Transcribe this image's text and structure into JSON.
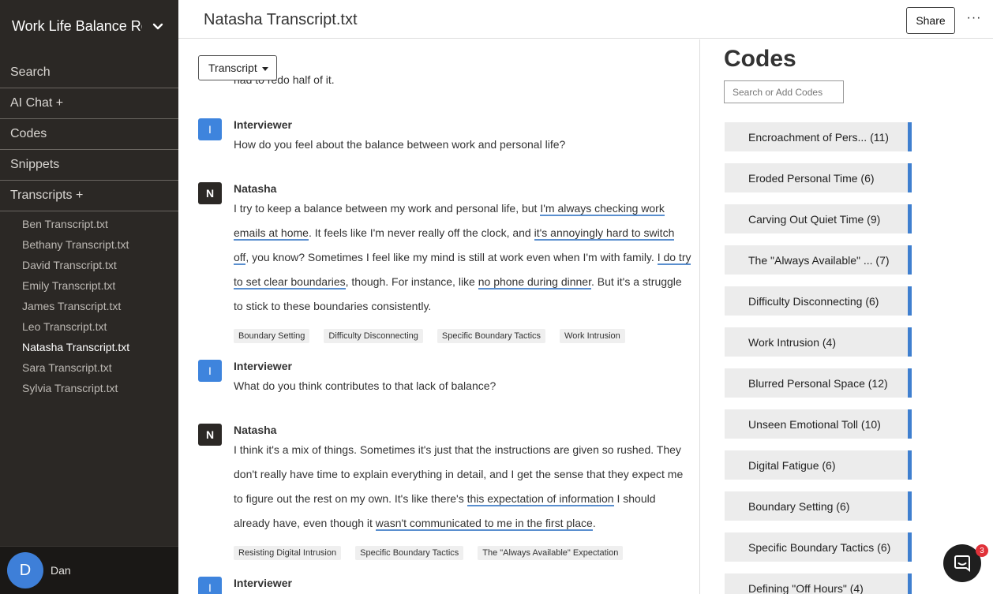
{
  "workspace": {
    "title": "Work Life Balance Re"
  },
  "nav": [
    {
      "label": "Search"
    },
    {
      "label": "AI Chat +"
    },
    {
      "label": "Codes"
    },
    {
      "label": "Snippets"
    },
    {
      "label": "Transcripts +"
    }
  ],
  "files": [
    "Ben Transcript.txt",
    "Bethany Transcript.txt",
    "David Transcript.txt",
    "Emily Transcript.txt",
    "James Transcript.txt",
    "Leo Transcript.txt",
    "Natasha Transcript.txt",
    "Sara Transcript.txt",
    "Sylvia Transcript.txt"
  ],
  "active_file": "Natasha Transcript.txt",
  "user": {
    "initial": "D",
    "name": "Dan"
  },
  "header": {
    "title": "Natasha Transcript.txt",
    "share": "Share",
    "more": "···"
  },
  "transcript": {
    "view_label": "Transcript",
    "cut_line": "had to redo half of it.",
    "messages": [
      {
        "badge": "I",
        "speaker": "Interviewer",
        "text": "How do you feel about the balance between work and personal life?"
      },
      {
        "badge": "N",
        "speaker": "Natasha",
        "p1": "I try to keep a balance between my work and personal life, but ",
        "h1": "I'm always checking work emails at home",
        "p2": ". It feels like I'm never really off the clock, and ",
        "h2": "it's annoyingly hard to switch off",
        "p3": ", you know? Sometimes I feel like my mind is still at work even when I'm with family. ",
        "h3": "I do try to set clear boundaries",
        "p4": ", though. For instance, like ",
        "h4": "no phone during dinner",
        "p5": ". But it's a struggle to stick to these boundaries consistently.",
        "tags": [
          "Boundary Setting",
          "Difficulty Disconnecting",
          "Specific Boundary Tactics",
          "Work Intrusion"
        ]
      },
      {
        "badge": "I",
        "speaker": "Interviewer",
        "text": "What do you think contributes to that lack of balance?"
      },
      {
        "badge": "N",
        "speaker": "Natasha",
        "p1": "I think it's a mix of things. Sometimes it's just that the instructions are given so rushed. They don't really have time to explain everything in detail, and I get the sense that they expect me to figure out the rest on my own. It's like there's ",
        "h1": "this expectation of information",
        "p2": " I should already have, even though it ",
        "h2": "wasn't communicated to me in the first place",
        "p3": ".",
        "tags": [
          "Resisting Digital Intrusion",
          "Specific Boundary Tactics",
          "The \"Always Available\" Expectation"
        ]
      },
      {
        "badge": "I",
        "speaker": "Interviewer"
      }
    ]
  },
  "codes": {
    "title": "Codes",
    "search_placeholder": "Search or Add Codes",
    "items": [
      {
        "label": "Encroachment of Pers...  (11)"
      },
      {
        "label": "Eroded Personal Time (6)"
      },
      {
        "label": "Carving Out Quiet Time (9)"
      },
      {
        "label": "The \"Always Available\" ...  (7)"
      },
      {
        "label": "Difficulty Disconnecting (6)"
      },
      {
        "label": "Work Intrusion (4)"
      },
      {
        "label": "Blurred Personal Space (12)"
      },
      {
        "label": "Unseen Emotional Toll (10)"
      },
      {
        "label": "Digital Fatigue (6)"
      },
      {
        "label": "Boundary Setting (6)"
      },
      {
        "label": "Specific Boundary Tactics (6)"
      },
      {
        "label": "Defining \"Off Hours\" (4)"
      }
    ]
  },
  "chat": {
    "count": "3"
  },
  "colors": {
    "sidebar": "#2b2825",
    "accent": "#3e84dd",
    "code_bar": "#3f7fcf",
    "notification": "#e0323a"
  }
}
